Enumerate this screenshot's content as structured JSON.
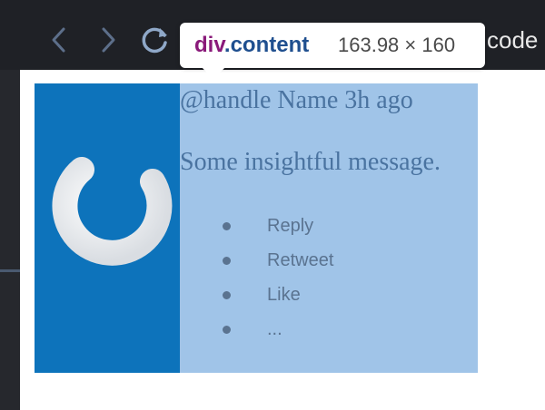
{
  "browser": {
    "url_fragment": "code",
    "icons": [
      "back-arrow-icon",
      "forward-arrow-icon",
      "reload-icon"
    ]
  },
  "tooltip": {
    "tag": "div",
    "class_name": ".content",
    "size": "163.98 × 160"
  },
  "tweet": {
    "meta": "@handle Name 3h ago",
    "message": "Some insightful message.",
    "actions": [
      "Reply",
      "Retweet",
      "Like",
      "..."
    ],
    "avatar_icon": "power-logo-icon"
  },
  "colors": {
    "chrome_bg": "#1f2126",
    "card_highlight": "#a0c4e8",
    "avatar_bg": "#0d73bb",
    "text": "#4a73a0",
    "tag_color": "#8a1a7a",
    "class_color": "#1f4f8f"
  }
}
